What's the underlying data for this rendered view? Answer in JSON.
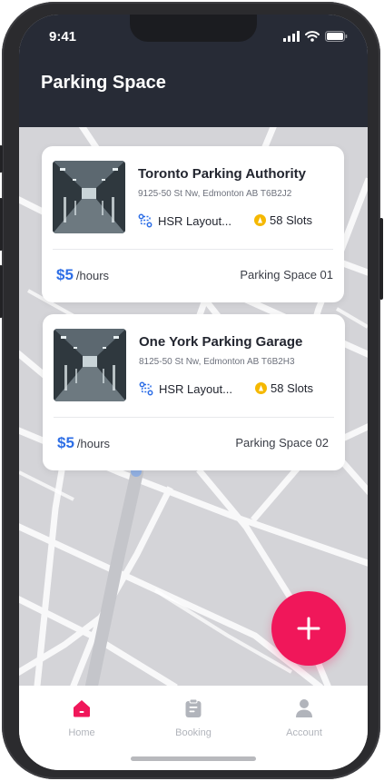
{
  "status_bar": {
    "time": "9:41"
  },
  "header": {
    "title": "Parking Space"
  },
  "cards": [
    {
      "name": "Toronto Parking Authority",
      "address": "9125-50 St Nw, Edmonton AB T6B2J2",
      "layout_label": "HSR Layout...",
      "slots_label": "58 Slots",
      "price": "$5",
      "price_unit": "/hours",
      "space_label": "Parking Space 01"
    },
    {
      "name": "One York Parking Garage",
      "address": "8125-50 St Nw, Edmonton AB T6B2H3",
      "layout_label": "HSR Layout...",
      "slots_label": "58 Slots",
      "price": "$5",
      "price_unit": "/hours",
      "space_label": "Parking Space 02"
    }
  ],
  "fab": {
    "icon": "plus-icon"
  },
  "nav": {
    "items": [
      {
        "label": "Home",
        "icon": "home-icon",
        "active": true
      },
      {
        "label": "Booking",
        "icon": "clipboard-icon",
        "active": false
      },
      {
        "label": "Account",
        "icon": "user-icon",
        "active": false
      }
    ]
  },
  "colors": {
    "header_bg": "#272b36",
    "accent": "#f0175a",
    "price": "#2d6ee6",
    "slot_badge": "#f5b800",
    "map_bg": "#d4d4d8"
  }
}
